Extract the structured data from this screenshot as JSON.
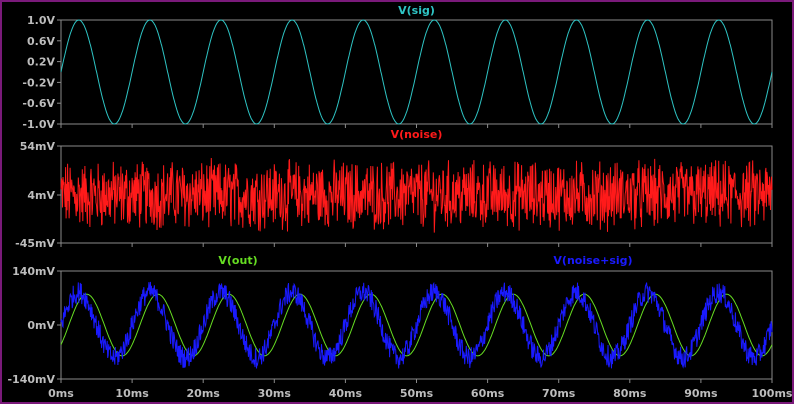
{
  "window": {
    "border_color": "#7a1a7a",
    "background": "#000000",
    "axis_color": "#8a8a8a"
  },
  "chart_data": [
    {
      "type": "line",
      "title": "",
      "series": [
        {
          "name": "V(sig)",
          "color": "#2ec4c4",
          "kind": "sine",
          "amplitude": 1.0,
          "offset": 0,
          "period_ms": 10,
          "phase_ms": 0
        }
      ],
      "ylim": [
        -1.0,
        1.0
      ],
      "yticks": [
        {
          "value": 1.0,
          "label": "1.0V"
        },
        {
          "value": 0.6,
          "label": "0.6V"
        },
        {
          "value": 0.2,
          "label": "0.2V"
        },
        {
          "value": -0.2,
          "label": "-0.2V"
        },
        {
          "value": -0.6,
          "label": "-0.6V"
        },
        {
          "value": -1.0,
          "label": "-1.0V"
        }
      ],
      "xlim": [
        0,
        100
      ],
      "xlabel": "",
      "ylabel": ""
    },
    {
      "type": "line",
      "title": "",
      "series": [
        {
          "name": "V(noise)",
          "color": "#ff1a1a",
          "kind": "noise",
          "mean": 4,
          "spread": 46,
          "amplitude": 30
        }
      ],
      "ylim": [
        -45,
        54
      ],
      "yticks": [
        {
          "value": 54,
          "label": "54mV"
        },
        {
          "value": 4,
          "label": "4mV"
        },
        {
          "value": -45,
          "label": "-45mV"
        }
      ],
      "xlim": [
        0,
        100
      ],
      "xlabel": "",
      "ylabel": ""
    },
    {
      "type": "line",
      "title": "",
      "series": [
        {
          "name": "V(out)",
          "color": "#66dd22",
          "kind": "sine",
          "amplitude": 80,
          "offset": 0,
          "period_ms": 10,
          "phase_ms": 1.1
        },
        {
          "name": "V(noise+sig)",
          "color": "#1a1aff",
          "kind": "sine_noise",
          "amplitude": 85,
          "offset": 0,
          "period_ms": 10,
          "phase_ms": 0,
          "noise": 28
        }
      ],
      "ylim": [
        -140,
        140
      ],
      "yticks": [
        {
          "value": 140,
          "label": "140mV"
        },
        {
          "value": 0,
          "label": "0mV"
        },
        {
          "value": -140,
          "label": "-140mV"
        }
      ],
      "xlim": [
        0,
        100
      ],
      "xticks": [
        {
          "value": 0,
          "label": "0ms"
        },
        {
          "value": 10,
          "label": "10ms"
        },
        {
          "value": 20,
          "label": "20ms"
        },
        {
          "value": 30,
          "label": "30ms"
        },
        {
          "value": 40,
          "label": "40ms"
        },
        {
          "value": 50,
          "label": "50ms"
        },
        {
          "value": 60,
          "label": "60ms"
        },
        {
          "value": 70,
          "label": "70ms"
        },
        {
          "value": 80,
          "label": "80ms"
        },
        {
          "value": 90,
          "label": "90ms"
        },
        {
          "value": 100,
          "label": "100ms"
        }
      ],
      "xlabel": "",
      "ylabel": ""
    }
  ]
}
